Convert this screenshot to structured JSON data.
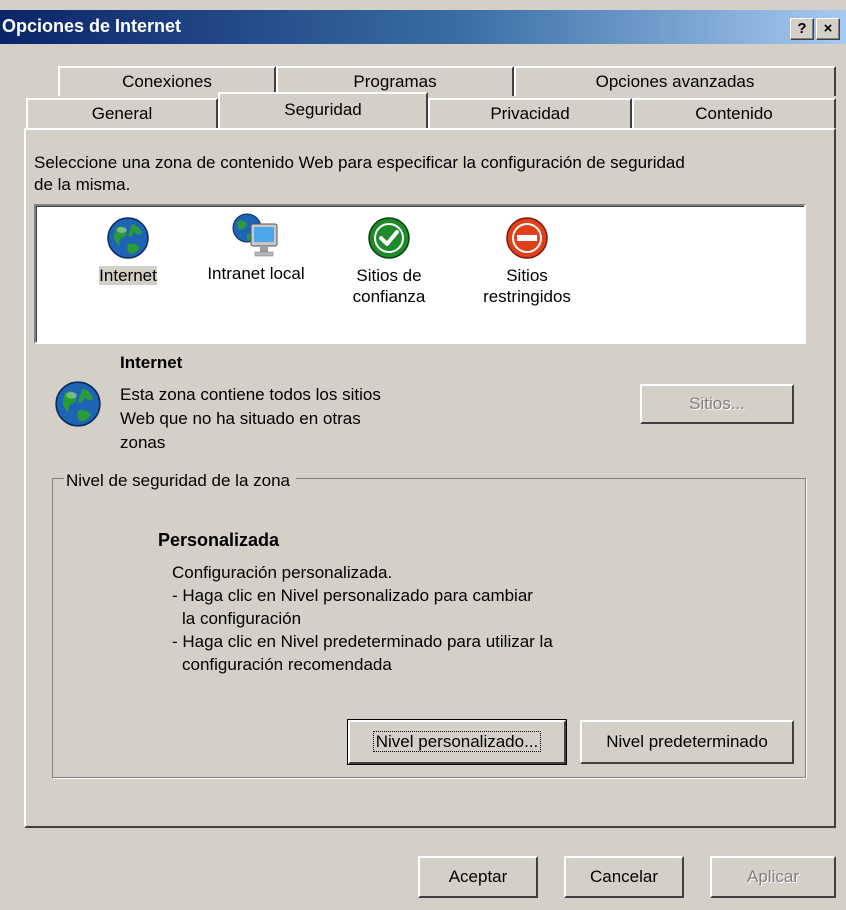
{
  "window": {
    "title": "Opciones de Internet",
    "help_label": "?",
    "close_label": "×"
  },
  "tabs_top": [
    "Conexiones",
    "Programas",
    "Opciones avanzadas"
  ],
  "tabs_bottom": [
    "General",
    "Seguridad",
    "Privacidad",
    "Contenido"
  ],
  "active_tab": "Seguridad",
  "instructions": {
    "line1": "Seleccione una zona de contenido Web para especificar la configuración de seguridad",
    "line2": "de la misma."
  },
  "zones": [
    {
      "line1": "Internet",
      "line2": "",
      "icon": "globe-icon",
      "selected": true
    },
    {
      "line1": "Intranet local",
      "line2": "",
      "icon": "intranet-icon",
      "selected": false
    },
    {
      "line1": "Sitios de",
      "line2": "confianza",
      "icon": "trusted-check-icon",
      "selected": false
    },
    {
      "line1": "Sitios",
      "line2": "restringidos",
      "icon": "restricted-icon",
      "selected": false
    }
  ],
  "zone_info": {
    "title": "Internet",
    "desc1": "Esta zona contiene todos los sitios",
    "desc2": "Web que no ha situado en otras",
    "desc3": "zonas",
    "sites_button": "Sitios..."
  },
  "security_level": {
    "legend": "Nivel de seguridad de la zona",
    "title": "Personalizada",
    "line1": "Configuración personalizada.",
    "line2": "- Haga clic en Nivel personalizado para cambiar",
    "line3": "la configuración",
    "line4": "- Haga clic en Nivel predeterminado para utilizar la",
    "line5": "configuración recomendada",
    "custom_button": "Nivel personalizado...",
    "default_button": "Nivel predeterminado"
  },
  "footer": {
    "ok": "Aceptar",
    "cancel": "Cancelar",
    "apply": "Aplicar"
  },
  "colors": {
    "title_start": "#0a246a",
    "title_end": "#a6caf0",
    "face": "#d4d0c8",
    "trusted": "#1f8a2a",
    "restricted": "#e0401a"
  }
}
